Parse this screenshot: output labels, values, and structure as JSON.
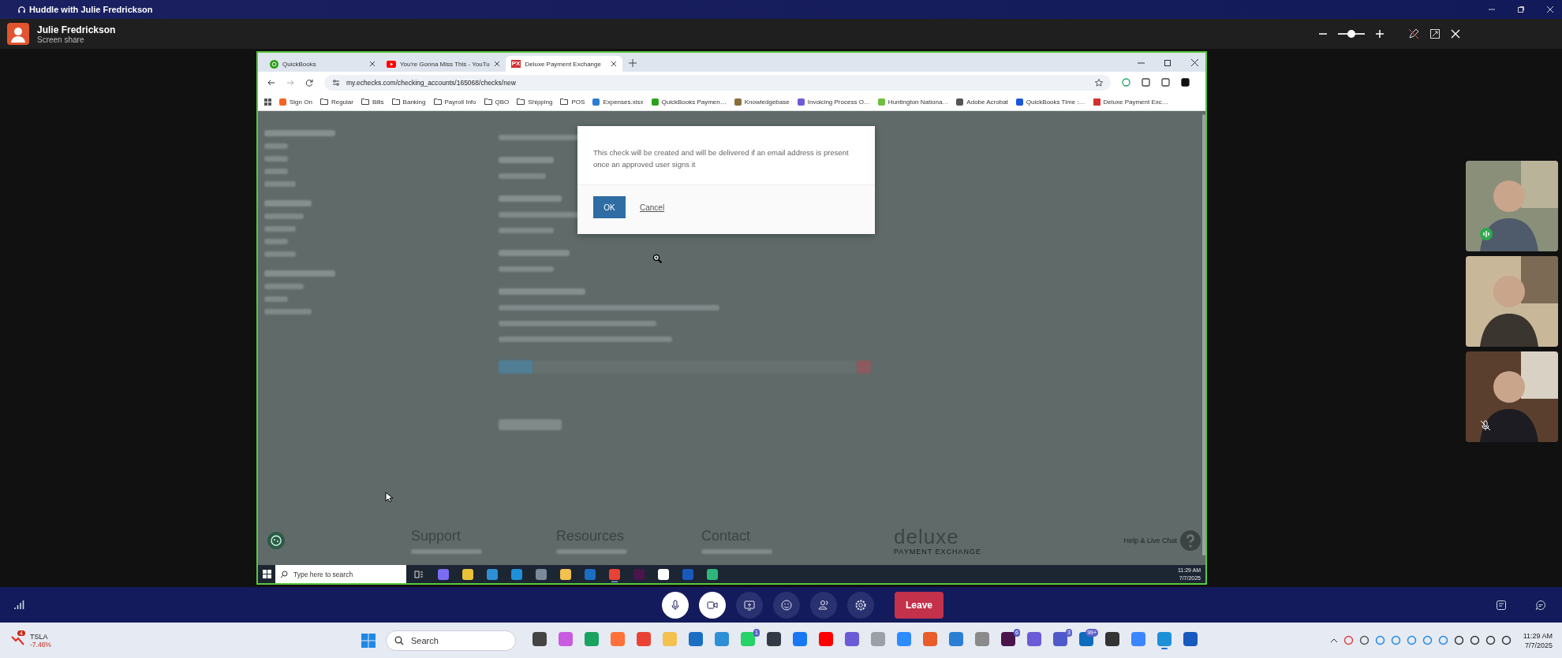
{
  "window": {
    "title": "Huddle with Julie Fredrickson"
  },
  "presenter": {
    "name": "Julie Fredrickson",
    "status": "Screen share"
  },
  "zoom": {
    "level": 0.5
  },
  "browser": {
    "tabs": [
      {
        "title": "QuickBooks",
        "kind": "qb",
        "selected": false
      },
      {
        "title": "You're Gonna Miss This - YouTu",
        "kind": "video",
        "selected": false
      },
      {
        "title": "Deluxe Payment Exchange",
        "kind": "px",
        "selected": true
      }
    ],
    "tab_badge": "PX",
    "url": "my.echecks.com/checking_accounts/165068/checks/new",
    "bookmarks": [
      {
        "label": "Sign On",
        "kind": "site",
        "color": "#f26522"
      },
      {
        "label": "Regular",
        "kind": "folder"
      },
      {
        "label": "Bills",
        "kind": "folder"
      },
      {
        "label": "Banking",
        "kind": "folder"
      },
      {
        "label": "Payroll Info",
        "kind": "folder"
      },
      {
        "label": "QBO",
        "kind": "folder"
      },
      {
        "label": "Shipping",
        "kind": "folder"
      },
      {
        "label": "POS",
        "kind": "folder"
      },
      {
        "label": "Expenses.xlsx",
        "kind": "site",
        "color": "#2b7cd3"
      },
      {
        "label": "QuickBooks Paymen…",
        "kind": "site",
        "color": "#2ca01c"
      },
      {
        "label": "Knowledgebase",
        "kind": "site",
        "color": "#8a6d3b"
      },
      {
        "label": "Invoicing Process O…",
        "kind": "site",
        "color": "#6b5bd6"
      },
      {
        "label": "Huntington Nationa…",
        "kind": "site",
        "color": "#6fbf40"
      },
      {
        "label": "Adobe Acrobat",
        "kind": "site",
        "color": "#555555"
      },
      {
        "label": "QuickBooks Time :…",
        "kind": "site",
        "color": "#1a56db"
      },
      {
        "label": "Deluxe Payment Exc…",
        "kind": "px",
        "color": "#d32f2f"
      }
    ]
  },
  "page": {
    "footer": {
      "columns": [
        "Support",
        "Resources",
        "Contact"
      ],
      "logo": "deluxe",
      "tagline": "PAYMENT EXCHANGE",
      "help": "Help & Live Chat"
    }
  },
  "dialog": {
    "message": "This check will be created and will be delivered if an email address is present once an approved user signs it",
    "buttons": [
      {
        "label": "OK",
        "kind": "primary"
      },
      {
        "label": "Cancel",
        "kind": "link"
      }
    ]
  },
  "shared_taskbar": {
    "search_placeholder": "Type here to search",
    "time": "11:29 AM",
    "date": "7/7/2025",
    "apps": [
      {
        "color": "#7b6cf6",
        "active": false
      },
      {
        "color": "#e8c33a",
        "active": false
      },
      {
        "color": "#2d8fd5",
        "active": false
      },
      {
        "color": "#1e90d8",
        "active": false
      },
      {
        "color": "#7a8a9a",
        "active": false
      },
      {
        "color": "#f2c14e",
        "active": false
      },
      {
        "color": "#1b6ec2",
        "active": false
      },
      {
        "color": "#e94235",
        "active": true
      },
      {
        "color": "#4a154b",
        "active": false
      },
      {
        "color": "#ffffff",
        "active": false
      },
      {
        "color": "#185abd",
        "active": false
      },
      {
        "color": "#2fb67c",
        "active": false
      }
    ]
  },
  "participants": [
    {
      "speaking": true,
      "muted": false
    },
    {
      "speaking": false,
      "muted": false
    },
    {
      "speaking": false,
      "muted": true
    }
  ],
  "controls": {
    "buttons": [
      {
        "kind": "mic",
        "on": true
      },
      {
        "kind": "camera",
        "on": true
      },
      {
        "kind": "share",
        "on": false
      },
      {
        "kind": "react",
        "on": false
      },
      {
        "kind": "people",
        "on": false
      },
      {
        "kind": "settings",
        "on": false
      }
    ],
    "leave": "Leave"
  },
  "taskbar": {
    "ticker": {
      "symbol": "TSLA",
      "change": "-7.46%",
      "badge": "4"
    },
    "search_placeholder": "Search",
    "time": "11:29 AM",
    "date": "7/7/2025",
    "apps": [
      {
        "color": "#444444",
        "active": false
      },
      {
        "color": "#c85be0",
        "active": false
      },
      {
        "color": "#1aa260",
        "active": false
      },
      {
        "color": "#ff7139",
        "active": false
      },
      {
        "color": "#e94235",
        "active": false
      },
      {
        "color": "#f2c14e",
        "active": false
      },
      {
        "color": "#1b6ec2",
        "active": false
      },
      {
        "color": "#2d8fd5",
        "active": false
      },
      {
        "color": "#25d366",
        "badge": "1",
        "active": false
      },
      {
        "color": "#333a45",
        "active": false
      },
      {
        "color": "#1877f2",
        "active": false
      },
      {
        "color": "#ff0000",
        "active": false
      },
      {
        "color": "#6b5bd6",
        "active": false
      },
      {
        "color": "#9aa0a6",
        "active": false
      },
      {
        "color": "#2d8cff",
        "active": false
      },
      {
        "color": "#e85d2a",
        "active": false
      },
      {
        "color": "#2a7fd4",
        "active": false
      },
      {
        "color": "#8a8a8a",
        "active": false
      },
      {
        "color": "#4a154b",
        "badge": "6",
        "active": false
      },
      {
        "color": "#6b5bd6",
        "active": false
      },
      {
        "color": "#5059c9",
        "badge": "3",
        "active": false
      },
      {
        "color": "#0f6cbd",
        "badge": "99+",
        "active": false
      },
      {
        "color": "#333333",
        "active": false
      },
      {
        "color": "#3a86ff",
        "active": false
      },
      {
        "color": "#1e90d8",
        "active": true
      },
      {
        "color": "#185abd",
        "active": false
      }
    ]
  }
}
